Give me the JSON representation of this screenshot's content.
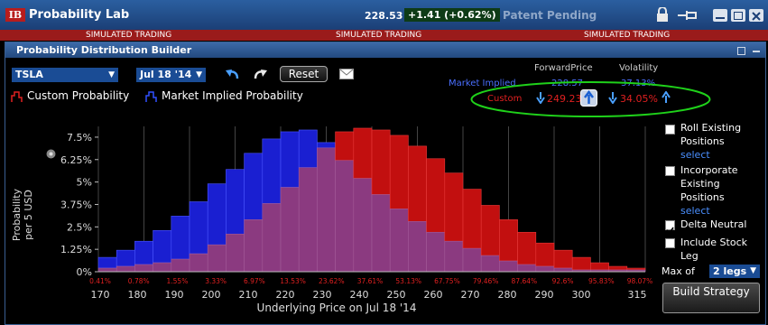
{
  "app": {
    "logo": "IB",
    "title": "Probability Lab",
    "price": "228.53",
    "change": "+1.41 (+0.62%)",
    "patent": "Patent Pending"
  },
  "sim_banner": [
    "SIMULATED TRADING",
    "SIMULATED TRADING",
    "SIMULATED TRADING"
  ],
  "panel": {
    "title": "Probability Distribution Builder"
  },
  "toolbar": {
    "symbol": "TSLA",
    "expiry": "Jul 18 '14",
    "reset_label": "Reset",
    "undo_icon": "undo-icon",
    "redo_icon": "redo-icon",
    "mail_icon": "mail-icon"
  },
  "legend": {
    "custom": "Custom Probability",
    "market": "Market Implied Probability"
  },
  "stats": {
    "fp_header": "ForwardPrice",
    "vol_header": "Volatility",
    "market_label": "Market Implied",
    "market_fp": "228.57",
    "market_vol": "37.13%",
    "custom_label": "Custom",
    "custom_fp": "249.23",
    "custom_vol": "34.05%"
  },
  "side": {
    "roll": "Roll Existing Positions",
    "roll_select": "select",
    "incorporate": "Incorporate Existing Positions",
    "incorporate_select": "select",
    "delta": "Delta Neutral",
    "stock": "Include Stock Leg",
    "maxof": "Max of",
    "legs": "2 legs",
    "build": "Build Strategy"
  },
  "colors": {
    "market": "#1a1fd1",
    "custom": "#c20f0f",
    "overlap": "#8b3a80",
    "ellipse": "#1fd11a"
  },
  "chart_data": {
    "type": "bar",
    "ylabel": "Probability per 5 USD",
    "xlabel": "Underlying Price on Jul 18 '14",
    "ylim": [
      0,
      8.1
    ],
    "yticks": [
      "0%",
      "1.25%",
      "2.5%",
      "3.75%",
      "5%",
      "6.25%",
      "7.5%"
    ],
    "xticks": [
      "170",
      "180",
      "190",
      "200",
      "210",
      "220",
      "230",
      "240",
      "250",
      "260",
      "270",
      "280",
      "290",
      "300",
      "315"
    ],
    "cumulative_labels": [
      "0.41%",
      "0.78%",
      "1.55%",
      "3.33%",
      "6.97%",
      "13.53%",
      "23.62%",
      "37.61%",
      "53.13%",
      "67.75%",
      "79.46%",
      "87.64%",
      "92.6%",
      "95.83%",
      "98.07%"
    ],
    "series": [
      {
        "name": "Market Implied Probability",
        "values": [
          0.8,
          1.2,
          1.7,
          2.3,
          3.1,
          3.9,
          4.9,
          5.7,
          6.6,
          7.4,
          7.8,
          7.9,
          7.2,
          6.2,
          5.2,
          4.3,
          3.5,
          2.8,
          2.2,
          1.7,
          1.3,
          0.9,
          0.6,
          0.4,
          0.3,
          0.2,
          0.1,
          0.1,
          0.1,
          0.1
        ]
      },
      {
        "name": "Custom Probability",
        "values": [
          0.2,
          0.3,
          0.4,
          0.5,
          0.7,
          1.0,
          1.5,
          2.1,
          2.9,
          3.8,
          4.7,
          5.8,
          6.9,
          7.8,
          8.0,
          7.9,
          7.6,
          7.0,
          6.3,
          5.5,
          4.6,
          3.7,
          2.9,
          2.2,
          1.6,
          1.2,
          0.8,
          0.5,
          0.3,
          0.2
        ]
      }
    ]
  }
}
